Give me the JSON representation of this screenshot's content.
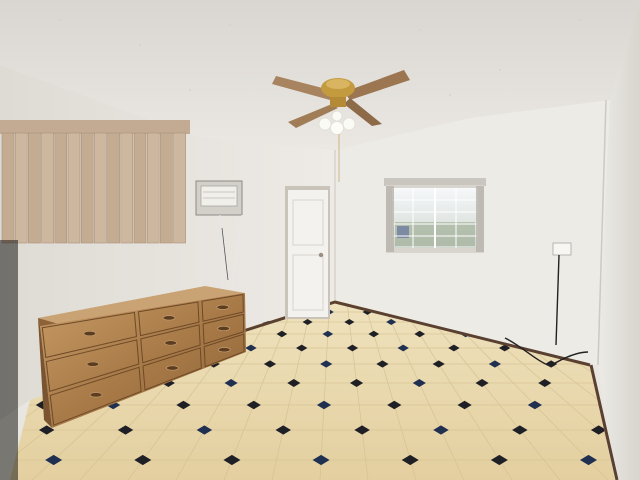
{
  "image": {
    "kind": "photograph",
    "subject": "empty bedroom",
    "colors": {
      "ceiling": "#e4e1dc",
      "wall_left": "#ebe8e3",
      "wall_back": "#ecebe6",
      "wall_right": "#e6e3de",
      "floor_tile": "#eadbb3",
      "floor_dot": "#1f1f26",
      "baseboard": "#5a4030",
      "dresser": "#b58a58",
      "dresser_dark": "#8d6237",
      "blinds": "#c9b39a",
      "fan_blade": "#9c7a5c",
      "fan_brass": "#c49a3f"
    },
    "objects": [
      "ceiling-fan",
      "vertical-blinds",
      "wall-ac-unit",
      "door",
      "window",
      "dresser",
      "tiled-floor",
      "power-outlet"
    ]
  }
}
